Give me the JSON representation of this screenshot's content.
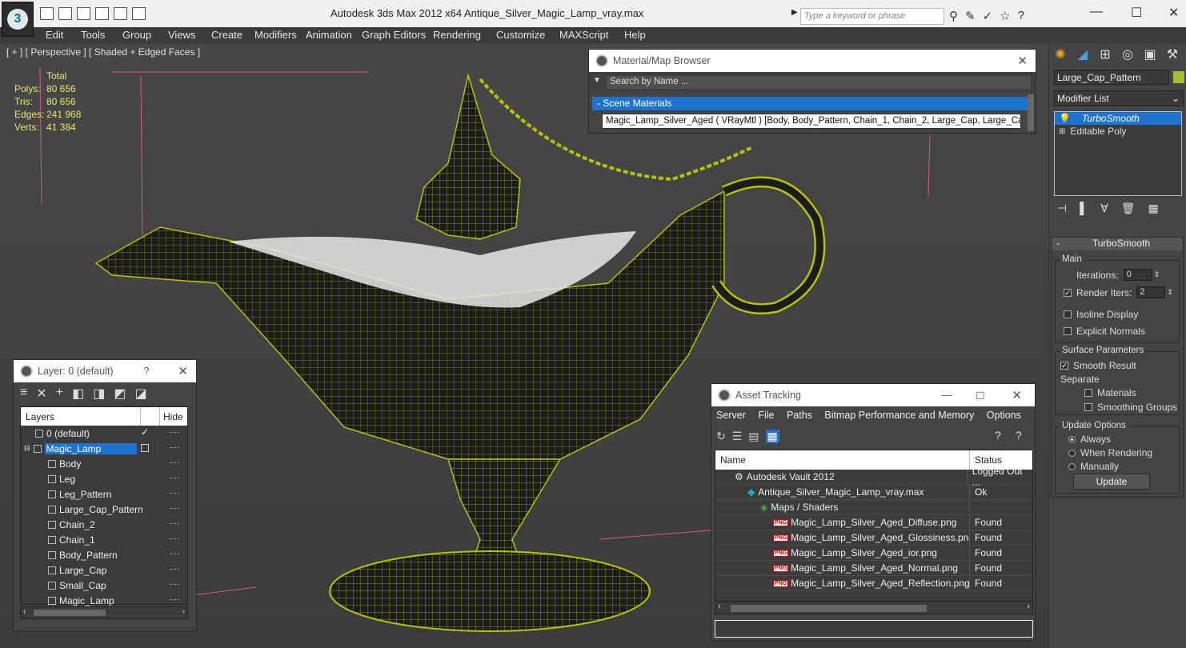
{
  "app": {
    "title": "Autodesk 3ds Max  2012 x64      Antique_Silver_Magic_Lamp_vray.max",
    "search_placeholder": "Type a keyword or phrase"
  },
  "menu": [
    "Edit",
    "Tools",
    "Group",
    "Views",
    "Create",
    "Modifiers",
    "Animation",
    "Graph Editors",
    "Rendering",
    "Customize",
    "MAXScript",
    "Help"
  ],
  "viewport": {
    "label": "[ + ] [ Perspective ] [ Shaded + Edged Faces ]",
    "stats": {
      "header": "Total",
      "rows": [
        {
          "k": "Polys:",
          "v": "80 656"
        },
        {
          "k": "Tris:",
          "v": "80 656"
        },
        {
          "k": "Edges:",
          "v": "241 968"
        },
        {
          "k": "Verts:",
          "v": "41 384"
        }
      ]
    }
  },
  "material_browser": {
    "title": "Material/Map Browser",
    "search": "Search by Name ...",
    "group": "- Scene Materials",
    "item": "Magic_Lamp_Silver_Aged  ( VRayMtl ) [Body, Body_Pattern, Chain_1, Chain_2, Large_Cap, Large_Ca..."
  },
  "layer_panel": {
    "title": "Layer: 0 (default)",
    "help": "?",
    "col_layers": "Layers",
    "col_hide": "Hide",
    "default_layer": "0 (default)",
    "selected_layer": "Magic_Lamp",
    "objects": [
      "Body",
      "Leg",
      "Leg_Pattern",
      "Large_Cap_Pattern",
      "Chain_2",
      "Chain_1",
      "Body_Pattern",
      "Large_Cap",
      "Small_Cap",
      "Magic_Lamp"
    ]
  },
  "asset_tracking": {
    "title": "Asset Tracking",
    "menus": [
      "Server",
      "File",
      "Paths",
      "Bitmap Performance and Memory",
      "Options"
    ],
    "col_name": "Name",
    "col_status": "Status",
    "rows": [
      {
        "name": "Autodesk Vault 2012",
        "status": "Logged Out ...",
        "indent": 1,
        "icon": "vault-icon"
      },
      {
        "name": "Antique_Silver_Magic_Lamp_vray.max",
        "status": "Ok",
        "indent": 2,
        "icon": "max-file-icon"
      },
      {
        "name": "Maps / Shaders",
        "status": "",
        "indent": 3,
        "icon": "maps-icon"
      },
      {
        "name": "Magic_Lamp_Silver_Aged_Diffuse.png",
        "status": "Found",
        "indent": 4,
        "icon": "png-icon"
      },
      {
        "name": "Magic_Lamp_Silver_Aged_Glossiness.png",
        "status": "Found",
        "indent": 4,
        "icon": "png-icon"
      },
      {
        "name": "Magic_Lamp_Silver_Aged_ior.png",
        "status": "Found",
        "indent": 4,
        "icon": "png-icon"
      },
      {
        "name": "Magic_Lamp_Silver_Aged_Normal.png",
        "status": "Found",
        "indent": 4,
        "icon": "png-icon"
      },
      {
        "name": "Magic_Lamp_Silver_Aged_Reflection.png",
        "status": "Found",
        "indent": 4,
        "icon": "png-icon"
      }
    ],
    "png_badge": "PNG"
  },
  "command_panel": {
    "object_name": "Large_Cap_Pattern",
    "object_color": "#a8bb2a",
    "modifier_list": "Modifier List",
    "stack": [
      "TurboSmooth",
      "Editable Poly"
    ],
    "rollout_title": "TurboSmooth",
    "main_label": "Main",
    "iterations_label": "Iterations:",
    "iterations": "0",
    "render_iters_label": "Render Iters:",
    "render_iters": "2",
    "isoline": "Isoline Display",
    "explicit_normals": "Explicit Normals",
    "surface_label": "Surface Parameters",
    "smooth_result": "Smooth Result",
    "separate_label": "Separate",
    "materials": "Materials",
    "smoothing_groups": "Smoothing Groups",
    "update_label": "Update Options",
    "always": "Always",
    "when_rendering": "When Rendering",
    "manually": "Manually",
    "update_button": "Update"
  },
  "colors": {
    "wire": "#b5c400",
    "selection": "#1e73d1",
    "stats": "#e9e66a"
  }
}
